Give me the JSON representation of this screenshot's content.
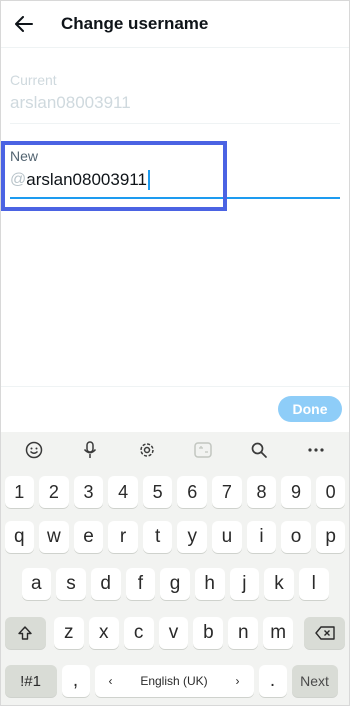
{
  "header": {
    "title": "Change username",
    "back_icon": "arrow-left-icon"
  },
  "current": {
    "label": "Current",
    "value": "arslan08003911"
  },
  "new_field": {
    "label": "New",
    "prefix": "@",
    "value": "arslan08003911"
  },
  "done_label": "Done",
  "colors": {
    "accent": "#1d9bf0",
    "highlight": "#4b63e3",
    "done_disabled": "#8ecdf8"
  },
  "keyboard": {
    "toolbar": [
      "emoji-icon",
      "microphone-icon",
      "settings-icon",
      "translate-icon",
      "search-icon",
      "more-icon"
    ],
    "numbers": [
      "1",
      "2",
      "3",
      "4",
      "5",
      "6",
      "7",
      "8",
      "9",
      "0"
    ],
    "row1": [
      "q",
      "w",
      "e",
      "r",
      "t",
      "y",
      "u",
      "i",
      "o",
      "p"
    ],
    "row2": [
      "a",
      "s",
      "d",
      "f",
      "g",
      "h",
      "j",
      "k",
      "l"
    ],
    "row3": [
      "z",
      "x",
      "c",
      "v",
      "b",
      "n",
      "m"
    ],
    "symbols_label": "!#1",
    "comma": ",",
    "space_label": "English (UK)",
    "space_left": "‹",
    "space_right": "›",
    "period": ".",
    "next_label": "Next"
  }
}
